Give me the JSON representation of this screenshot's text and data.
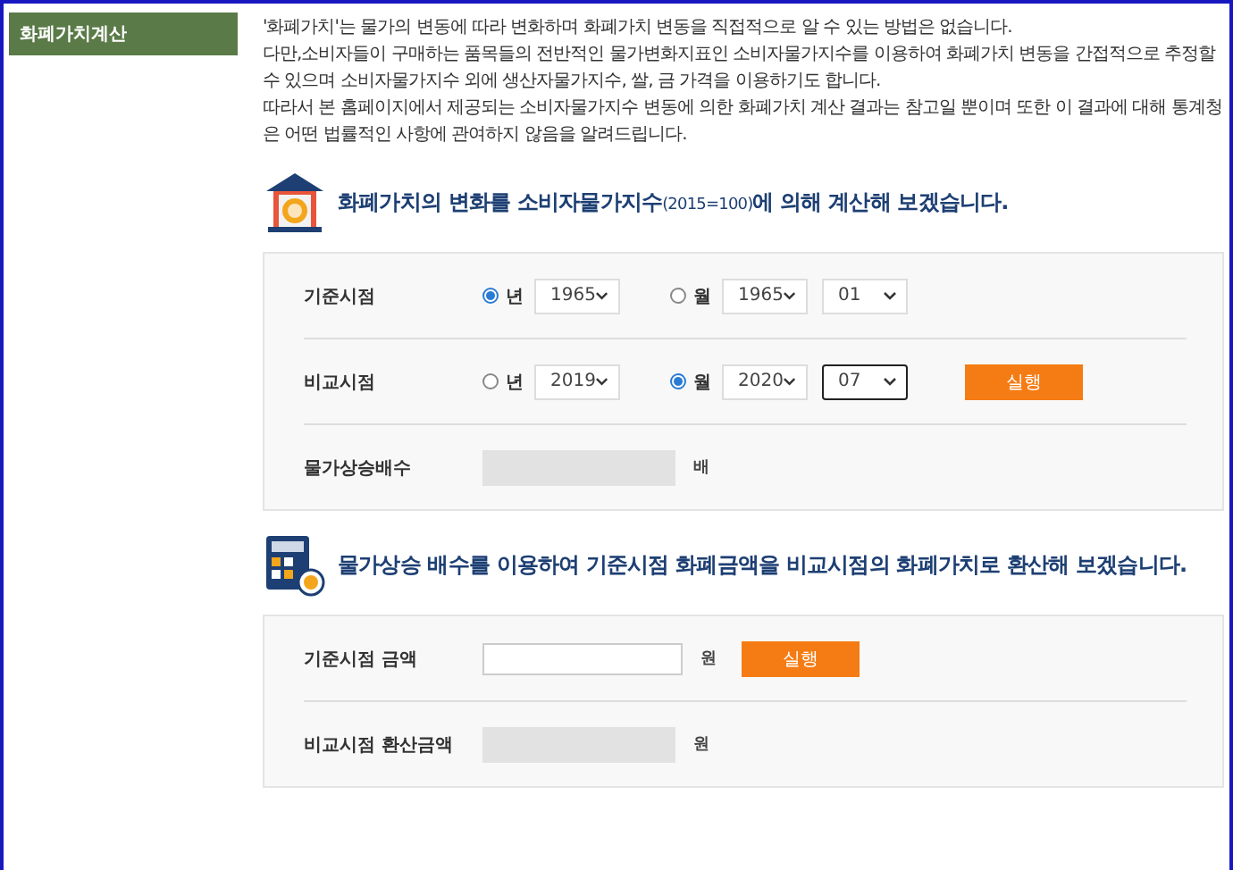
{
  "sidebar": {
    "items": [
      {
        "label": "화폐가치계산",
        "selected": true
      }
    ]
  },
  "intro": {
    "paragraphs": [
      "'화폐가치'는 물가의 변동에 따라 변화하며 화폐가치 변동을 직접적으로 알 수 있는 방법은 없습니다.",
      "다만,소비자들이 구매하는 품목들의 전반적인 물가변화지표인 소비자물가지수를 이용하여 화폐가치 변동을 간접적으로 추정할 수 있으며 소비자물가지수 외에 생산자물가지수, 쌀, 금 가격을 이용하기도 합니다.",
      "따라서 본 홈페이지에서 제공되는 소비자물가지수 변동에 의한 화폐가치 계산 결과는 참고일 뿐이며 또한 이 결과에 대해 통계청은 어떤 법률적인 사항에 관여하지 않음을 알려드립니다."
    ]
  },
  "sections": [
    {
      "heading": "화폐가치의 변화를 소비자물가지수$_{(2015=100)}$에 의해 계산해 보겠습니다.",
      "rows": [
        {
          "kind": "period",
          "label": "기준시점",
          "options": [
            {
              "label": "년",
              "selected": true,
              "selects": [
                {
                  "value": "1965",
                  "focused": false
                }
              ]
            },
            {
              "label": "월",
              "selected": false,
              "selects": [
                {
                  "value": "1965",
                  "focused": false
                },
                {
                  "value": "01",
                  "focused": false
                }
              ]
            }
          ]
        },
        {
          "kind": "period",
          "label": "비교시점",
          "options": [
            {
              "label": "년",
              "selected": false,
              "selects": [
                {
                  "value": "2019",
                  "focused": false
                }
              ]
            },
            {
              "label": "월",
              "selected": true,
              "selects": [
                {
                  "value": "2020",
                  "focused": false
                },
                {
                  "value": "07",
                  "focused": true
                }
              ]
            }
          ],
          "button": "실행"
        },
        {
          "kind": "output",
          "label": "물가상승배수",
          "unit": "배"
        }
      ]
    },
    {
      "heading": "물가상승 배수를 이용하여 기준시점 화폐금액을 비교시점의 화폐가치로 환산해 보겠습니다.",
      "rows": [
        {
          "kind": "input",
          "label": "기준시점 금액",
          "unit": "원",
          "button": "실행"
        },
        {
          "kind": "output",
          "label": "비교시점 환산금액",
          "unit": "원"
        }
      ]
    }
  ]
}
